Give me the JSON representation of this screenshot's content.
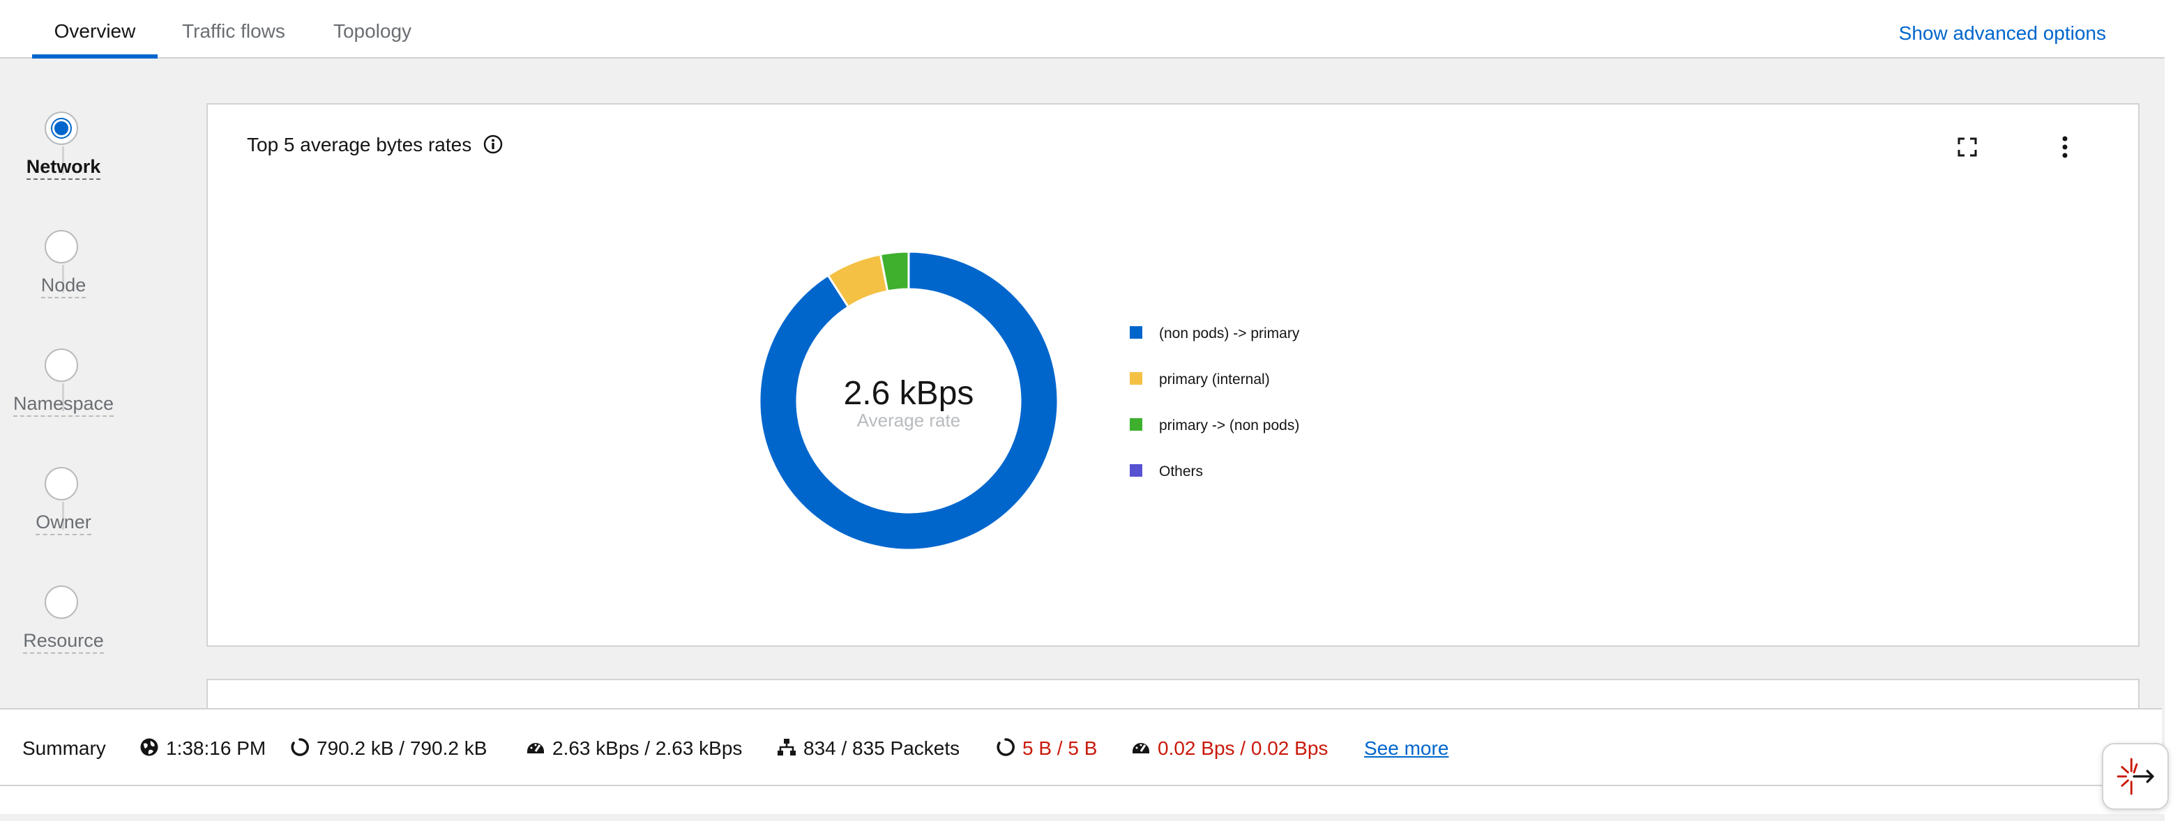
{
  "tabs": [
    {
      "label": "Overview",
      "active": true
    },
    {
      "label": "Traffic flows",
      "active": false
    },
    {
      "label": "Topology",
      "active": false
    }
  ],
  "advanced_options_label": "Show advanced options",
  "scopes": [
    {
      "label": "Network",
      "selected": true
    },
    {
      "label": "Node",
      "selected": false
    },
    {
      "label": "Namespace",
      "selected": false
    },
    {
      "label": "Owner",
      "selected": false
    },
    {
      "label": "Resource",
      "selected": false
    }
  ],
  "card": {
    "title": "Top 5 average bytes rates",
    "center_value": "2.6 kBps",
    "center_label": "Average rate"
  },
  "chart_data": {
    "type": "pie",
    "title": "Top 5 average bytes rates",
    "center_text": "2.6 kBps",
    "center_subtext": "Average rate",
    "legend_position": "right",
    "categories": [
      "(non pods) -> primary",
      "primary (internal)",
      "primary -> (non pods)",
      "Others"
    ],
    "values": [
      90,
      6,
      3,
      0
    ],
    "colors": [
      "#0066cc",
      "#f4c145",
      "#3eb02e",
      "#5752d1"
    ]
  },
  "summary": {
    "label": "Summary",
    "time": "1:38:16 PM",
    "bytes": "790.2 kB / 790.2 kB",
    "byte_rate": "2.63 kBps / 2.63 kBps",
    "packets": "834 / 835 Packets",
    "dropped_bytes": "5 B / 5 B",
    "dropped_rate": "0.02 Bps / 0.02 Bps",
    "see_more": "See more"
  },
  "icons": {
    "info": "info-circle-icon",
    "expand": "expand-icon",
    "kebab": "kebab-menu-icon",
    "globe": "globe-icon",
    "bytes": "circle-notch-icon",
    "rate": "tachometer-icon",
    "packets": "network-icon",
    "dropped": "circle-notch-icon",
    "dropped_rate": "tachometer-icon",
    "assistant": "assistant-launcher-icon"
  }
}
